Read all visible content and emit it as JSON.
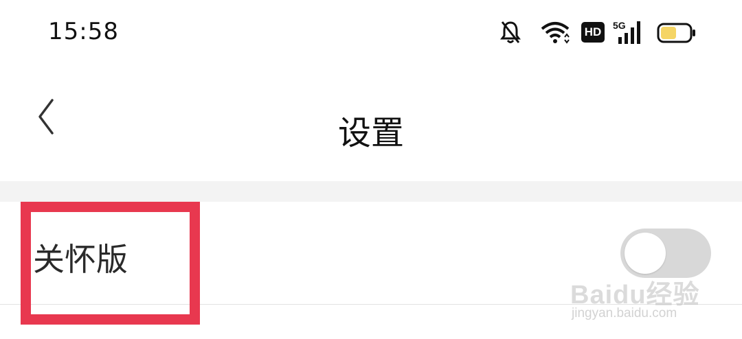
{
  "status_bar": {
    "time": "15:58",
    "hd_label": "HD",
    "network_label": "5G",
    "icons": [
      "mute-bell-icon",
      "wifi-icon",
      "hd-icon",
      "5g-signal-icon",
      "battery-icon"
    ],
    "battery_level": 0.55,
    "battery_color": "#f5d565"
  },
  "nav": {
    "title": "设置",
    "back_icon": "chevron-left-icon"
  },
  "settings": {
    "items": [
      {
        "label": "关怀版",
        "toggle_on": false
      }
    ]
  },
  "annotation": {
    "highlight_color": "#e8384f"
  },
  "watermark": {
    "brand": "Baidu经验",
    "url": "jingyan.baidu.com"
  }
}
